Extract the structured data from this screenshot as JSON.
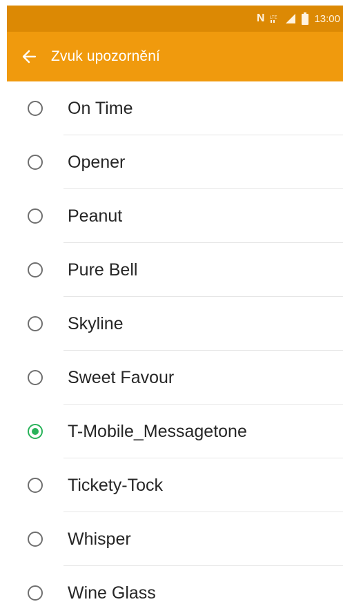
{
  "status_bar": {
    "time": "13:00",
    "icons": [
      "nfc-icon",
      "lte-icon",
      "signal-icon",
      "battery-icon"
    ],
    "nfc_glyph": "N",
    "lte_glyph": "LTE"
  },
  "header": {
    "back_icon": "arrow-left-icon",
    "title": "Zvuk upozornění"
  },
  "ringtones": [
    {
      "label": "On Time",
      "selected": false
    },
    {
      "label": "Opener",
      "selected": false
    },
    {
      "label": "Peanut",
      "selected": false
    },
    {
      "label": "Pure Bell",
      "selected": false
    },
    {
      "label": "Skyline",
      "selected": false
    },
    {
      "label": "Sweet Favour",
      "selected": false
    },
    {
      "label": "T-Mobile_Messagetone",
      "selected": true
    },
    {
      "label": "Tickety-Tock",
      "selected": false
    },
    {
      "label": "Whisper",
      "selected": false
    },
    {
      "label": "Wine Glass",
      "selected": false
    }
  ],
  "colors": {
    "status_bar": "#dc8904",
    "action_bar": "#f09a0d",
    "accent_selected": "#29b35a"
  }
}
